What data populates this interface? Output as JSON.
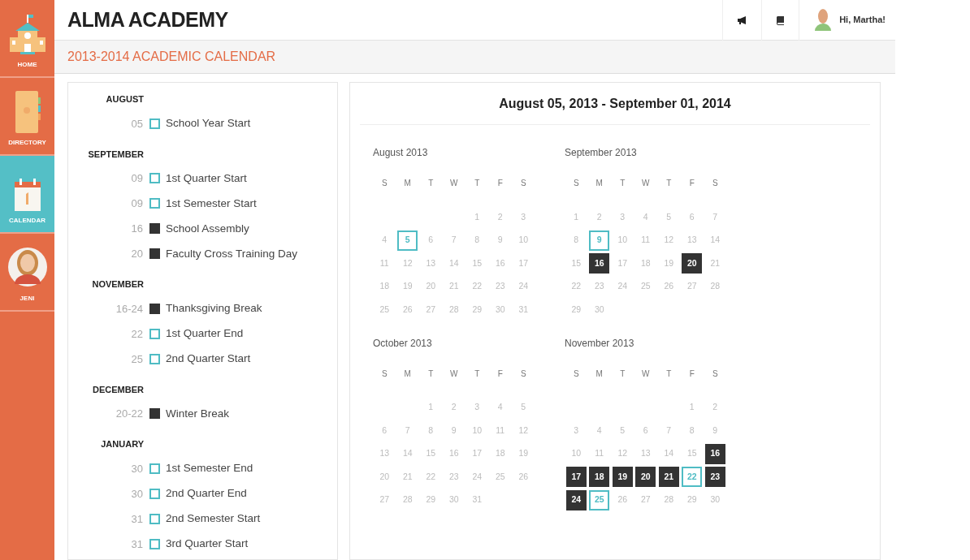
{
  "sidebar": {
    "items": [
      {
        "kind": "home",
        "label": "HOME",
        "selected": false
      },
      {
        "kind": "directory",
        "label": "DIRECTORY",
        "selected": false
      },
      {
        "kind": "calendar",
        "label": "CALENDAR",
        "selected": true
      },
      {
        "kind": "profile",
        "label": "JENI",
        "selected": false
      }
    ]
  },
  "header": {
    "title": "ALMA ACADEMY",
    "greeting": "Hi, Martha!"
  },
  "page_title": "2013-2014 ACADEMIC CALENDAR",
  "events": [
    {
      "month": "AUGUST",
      "items": [
        {
          "date": "05",
          "kind": "outline",
          "label": "School Year Start"
        }
      ]
    },
    {
      "month": "SEPTEMBER",
      "items": [
        {
          "date": "09",
          "kind": "outline",
          "label": "1st Quarter Start"
        },
        {
          "date": "09",
          "kind": "outline",
          "label": "1st Semester Start"
        },
        {
          "date": "16",
          "kind": "filled",
          "label": "School Assembly"
        },
        {
          "date": "20",
          "kind": "filled",
          "label": "Faculty Cross Training Day"
        }
      ]
    },
    {
      "month": "NOVEMBER",
      "items": [
        {
          "date": "16-24",
          "kind": "filled",
          "label": "Thanksgiving Break"
        },
        {
          "date": "22",
          "kind": "outline",
          "label": "1st Quarter End"
        },
        {
          "date": "25",
          "kind": "outline",
          "label": "2nd Quarter Start"
        }
      ]
    },
    {
      "month": "DECEMBER",
      "items": [
        {
          "date": "20-22",
          "kind": "filled",
          "label": "Winter Break"
        }
      ]
    },
    {
      "month": "JANUARY",
      "items": [
        {
          "date": "30",
          "kind": "outline",
          "label": "1st Semester End"
        },
        {
          "date": "30",
          "kind": "outline",
          "label": "2nd Quarter End"
        },
        {
          "date": "31",
          "kind": "outline",
          "label": "2nd Semester Start"
        },
        {
          "date": "31",
          "kind": "outline",
          "label": "3rd Quarter Start"
        }
      ]
    }
  ],
  "range_title": "August 05, 2013 - September 01, 2014",
  "months": [
    {
      "title": "August 2013",
      "weekdays": [
        "S",
        "M",
        "T",
        "W",
        "T",
        "F",
        "S"
      ],
      "weeks": [
        [
          {
            "kind": "blank"
          },
          {
            "kind": "blank"
          },
          {
            "kind": "blank"
          },
          {
            "kind": "blank"
          },
          {
            "kind": "plain",
            "day": "1"
          },
          {
            "kind": "plain",
            "day": "2"
          },
          {
            "kind": "plain",
            "day": "3"
          }
        ],
        [
          {
            "kind": "plain",
            "day": "4"
          },
          {
            "kind": "outline",
            "day": "5"
          },
          {
            "kind": "plain",
            "day": "6"
          },
          {
            "kind": "plain",
            "day": "7"
          },
          {
            "kind": "plain",
            "day": "8"
          },
          {
            "kind": "plain",
            "day": "9"
          },
          {
            "kind": "plain",
            "day": "10"
          }
        ],
        [
          {
            "kind": "plain",
            "day": "11"
          },
          {
            "kind": "plain",
            "day": "12"
          },
          {
            "kind": "plain",
            "day": "13"
          },
          {
            "kind": "plain",
            "day": "14"
          },
          {
            "kind": "plain",
            "day": "15"
          },
          {
            "kind": "plain",
            "day": "16"
          },
          {
            "kind": "plain",
            "day": "17"
          }
        ],
        [
          {
            "kind": "plain",
            "day": "18"
          },
          {
            "kind": "plain",
            "day": "19"
          },
          {
            "kind": "plain",
            "day": "20"
          },
          {
            "kind": "plain",
            "day": "21"
          },
          {
            "kind": "plain",
            "day": "22"
          },
          {
            "kind": "plain",
            "day": "23"
          },
          {
            "kind": "plain",
            "day": "24"
          }
        ],
        [
          {
            "kind": "plain",
            "day": "25"
          },
          {
            "kind": "plain",
            "day": "26"
          },
          {
            "kind": "plain",
            "day": "27"
          },
          {
            "kind": "plain",
            "day": "28"
          },
          {
            "kind": "plain",
            "day": "29"
          },
          {
            "kind": "plain",
            "day": "30"
          },
          {
            "kind": "plain",
            "day": "31"
          }
        ]
      ]
    },
    {
      "title": "September 2013",
      "weekdays": [
        "S",
        "M",
        "T",
        "W",
        "T",
        "F",
        "S"
      ],
      "weeks": [
        [
          {
            "kind": "plain",
            "day": "1"
          },
          {
            "kind": "plain",
            "day": "2"
          },
          {
            "kind": "plain",
            "day": "3"
          },
          {
            "kind": "plain",
            "day": "4"
          },
          {
            "kind": "plain",
            "day": "5"
          },
          {
            "kind": "plain",
            "day": "6"
          },
          {
            "kind": "plain",
            "day": "7"
          }
        ],
        [
          {
            "kind": "plain",
            "day": "8"
          },
          {
            "kind": "outline",
            "day": "9"
          },
          {
            "kind": "plain",
            "day": "10"
          },
          {
            "kind": "plain",
            "day": "11"
          },
          {
            "kind": "plain",
            "day": "12"
          },
          {
            "kind": "plain",
            "day": "13"
          },
          {
            "kind": "plain",
            "day": "14"
          }
        ],
        [
          {
            "kind": "plain",
            "day": "15"
          },
          {
            "kind": "filled",
            "day": "16"
          },
          {
            "kind": "plain",
            "day": "17"
          },
          {
            "kind": "plain",
            "day": "18"
          },
          {
            "kind": "plain",
            "day": "19"
          },
          {
            "kind": "filled",
            "day": "20"
          },
          {
            "kind": "plain",
            "day": "21"
          }
        ],
        [
          {
            "kind": "plain",
            "day": "22"
          },
          {
            "kind": "plain",
            "day": "23"
          },
          {
            "kind": "plain",
            "day": "24"
          },
          {
            "kind": "plain",
            "day": "25"
          },
          {
            "kind": "plain",
            "day": "26"
          },
          {
            "kind": "plain",
            "day": "27"
          },
          {
            "kind": "plain",
            "day": "28"
          }
        ],
        [
          {
            "kind": "plain",
            "day": "29"
          },
          {
            "kind": "plain",
            "day": "30"
          },
          {
            "kind": "blank"
          },
          {
            "kind": "blank"
          },
          {
            "kind": "blank"
          },
          {
            "kind": "blank"
          },
          {
            "kind": "blank"
          }
        ]
      ]
    },
    {
      "title": "October 2013",
      "weekdays": [
        "S",
        "M",
        "T",
        "W",
        "T",
        "F",
        "S"
      ],
      "weeks": [
        [
          {
            "kind": "blank"
          },
          {
            "kind": "blank"
          },
          {
            "kind": "plain",
            "day": "1"
          },
          {
            "kind": "plain",
            "day": "2"
          },
          {
            "kind": "plain",
            "day": "3"
          },
          {
            "kind": "plain",
            "day": "4"
          },
          {
            "kind": "plain",
            "day": "5"
          }
        ],
        [
          {
            "kind": "plain",
            "day": "6"
          },
          {
            "kind": "plain",
            "day": "7"
          },
          {
            "kind": "plain",
            "day": "8"
          },
          {
            "kind": "plain",
            "day": "9"
          },
          {
            "kind": "plain",
            "day": "10"
          },
          {
            "kind": "plain",
            "day": "11"
          },
          {
            "kind": "plain",
            "day": "12"
          }
        ],
        [
          {
            "kind": "plain",
            "day": "13"
          },
          {
            "kind": "plain",
            "day": "14"
          },
          {
            "kind": "plain",
            "day": "15"
          },
          {
            "kind": "plain",
            "day": "16"
          },
          {
            "kind": "plain",
            "day": "17"
          },
          {
            "kind": "plain",
            "day": "18"
          },
          {
            "kind": "plain",
            "day": "19"
          }
        ],
        [
          {
            "kind": "plain",
            "day": "20"
          },
          {
            "kind": "plain",
            "day": "21"
          },
          {
            "kind": "plain",
            "day": "22"
          },
          {
            "kind": "plain",
            "day": "23"
          },
          {
            "kind": "plain",
            "day": "24"
          },
          {
            "kind": "plain",
            "day": "25"
          },
          {
            "kind": "plain",
            "day": "26"
          }
        ],
        [
          {
            "kind": "plain",
            "day": "27"
          },
          {
            "kind": "plain",
            "day": "28"
          },
          {
            "kind": "plain",
            "day": "29"
          },
          {
            "kind": "plain",
            "day": "30"
          },
          {
            "kind": "plain",
            "day": "31"
          },
          {
            "kind": "blank"
          },
          {
            "kind": "blank"
          }
        ]
      ]
    },
    {
      "title": "November 2013",
      "weekdays": [
        "S",
        "M",
        "T",
        "W",
        "T",
        "F",
        "S"
      ],
      "weeks": [
        [
          {
            "kind": "blank"
          },
          {
            "kind": "blank"
          },
          {
            "kind": "blank"
          },
          {
            "kind": "blank"
          },
          {
            "kind": "blank"
          },
          {
            "kind": "plain",
            "day": "1"
          },
          {
            "kind": "plain",
            "day": "2"
          }
        ],
        [
          {
            "kind": "plain",
            "day": "3"
          },
          {
            "kind": "plain",
            "day": "4"
          },
          {
            "kind": "plain",
            "day": "5"
          },
          {
            "kind": "plain",
            "day": "6"
          },
          {
            "kind": "plain",
            "day": "7"
          },
          {
            "kind": "plain",
            "day": "8"
          },
          {
            "kind": "plain",
            "day": "9"
          }
        ],
        [
          {
            "kind": "plain",
            "day": "10"
          },
          {
            "kind": "plain",
            "day": "11"
          },
          {
            "kind": "plain",
            "day": "12"
          },
          {
            "kind": "plain",
            "day": "13"
          },
          {
            "kind": "plain",
            "day": "14"
          },
          {
            "kind": "plain",
            "day": "15"
          },
          {
            "kind": "filled",
            "day": "16"
          }
        ],
        [
          {
            "kind": "filled",
            "day": "17"
          },
          {
            "kind": "filled",
            "day": "18"
          },
          {
            "kind": "filled",
            "day": "19"
          },
          {
            "kind": "filled",
            "day": "20"
          },
          {
            "kind": "filled",
            "day": "21"
          },
          {
            "kind": "outline",
            "day": "22"
          },
          {
            "kind": "filled",
            "day": "23"
          }
        ],
        [
          {
            "kind": "filled",
            "day": "24"
          },
          {
            "kind": "outline",
            "day": "25"
          },
          {
            "kind": "plain",
            "day": "26"
          },
          {
            "kind": "plain",
            "day": "27"
          },
          {
            "kind": "plain",
            "day": "28"
          },
          {
            "kind": "plain",
            "day": "29"
          },
          {
            "kind": "plain",
            "day": "30"
          }
        ]
      ]
    }
  ]
}
